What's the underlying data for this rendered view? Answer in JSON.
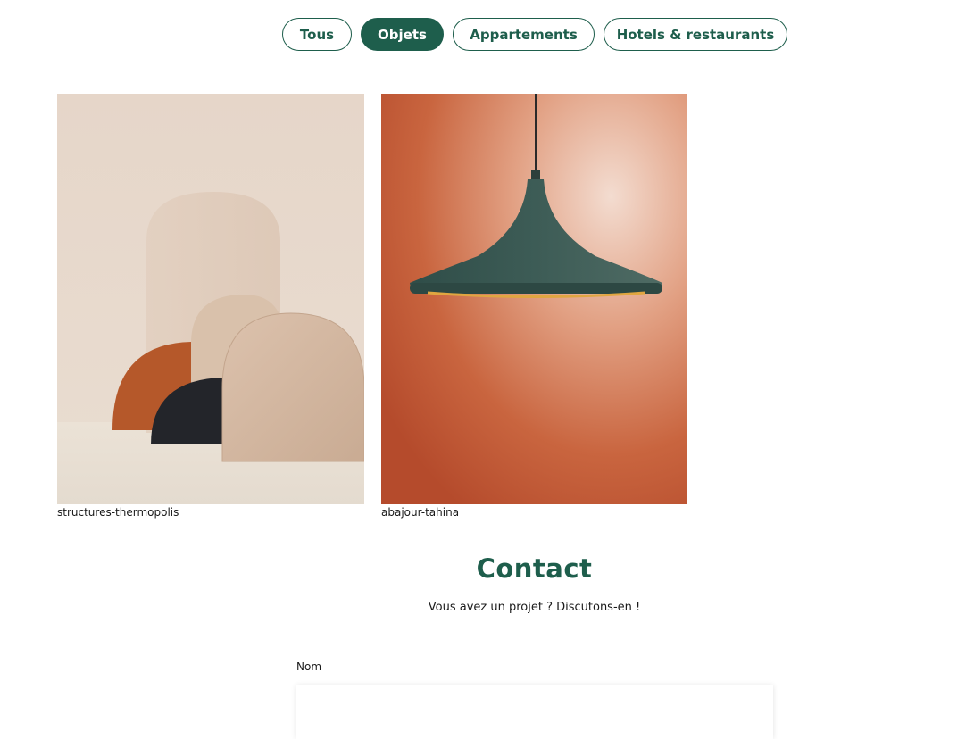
{
  "filters": {
    "items": [
      {
        "label": "Tous",
        "active": false
      },
      {
        "label": "Objets",
        "active": true
      },
      {
        "label": "Appartements",
        "active": false
      },
      {
        "label": "Hotels & restaurants",
        "active": false
      }
    ]
  },
  "gallery": {
    "items": [
      {
        "caption": "structures-thermopolis",
        "icon": "arch-structures-image"
      },
      {
        "caption": "abajour-tahina",
        "icon": "pendant-lamp-image"
      }
    ]
  },
  "contact": {
    "title": "Contact",
    "subtitle": "Vous avez un projet ? Discutons-en !",
    "name_label": "Nom",
    "name_value": ""
  },
  "colors": {
    "accent": "#1e5e4c",
    "lamp_bg": "#c96a4d",
    "structures_bg": "#e8d8cc"
  }
}
